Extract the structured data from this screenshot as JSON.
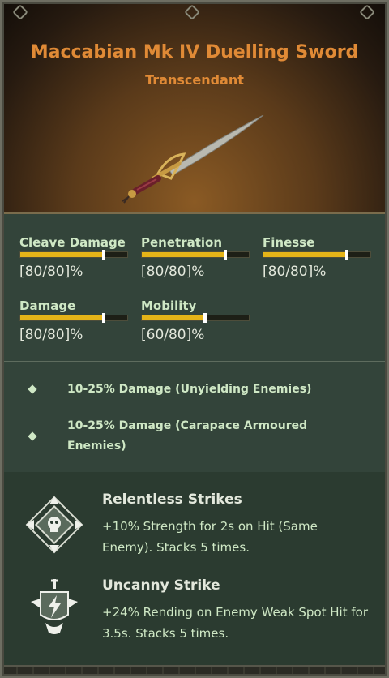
{
  "item": {
    "name": "Maccabian Mk IV Duelling Sword",
    "rarity": "Transcendant"
  },
  "stats": [
    {
      "label": "Cleave Damage",
      "value_text": "[80/80]%",
      "fill": 0.78
    },
    {
      "label": "Penetration",
      "value_text": "[80/80]%",
      "fill": 0.78
    },
    {
      "label": "Finesse",
      "value_text": "[80/80]%",
      "fill": 0.78
    },
    {
      "label": "Damage",
      "value_text": "[80/80]%",
      "fill": 0.78
    },
    {
      "label": "Mobility",
      "value_text": "[60/80]%",
      "fill": 0.58
    }
  ],
  "blessings": [
    {
      "text": "10-25% Damage (Unyielding Enemies)"
    },
    {
      "text": "10-25% Damage (Carapace Armoured Enemies)"
    }
  ],
  "perks": [
    {
      "title": "Relentless Strikes",
      "description": "+10% Strength for 2s on Hit (Same Enemy). Stacks 5 times.",
      "icon": "skull-arrows-icon"
    },
    {
      "title": "Uncanny Strike",
      "description": "+24% Rending on Enemy Weak Spot Hit for 3.5s. Stacks 5 times.",
      "icon": "lightning-crest-icon"
    }
  ],
  "colors": {
    "title": "#e08a36",
    "bar_fill": "#e5b418",
    "text_green": "#cfe8c5"
  }
}
